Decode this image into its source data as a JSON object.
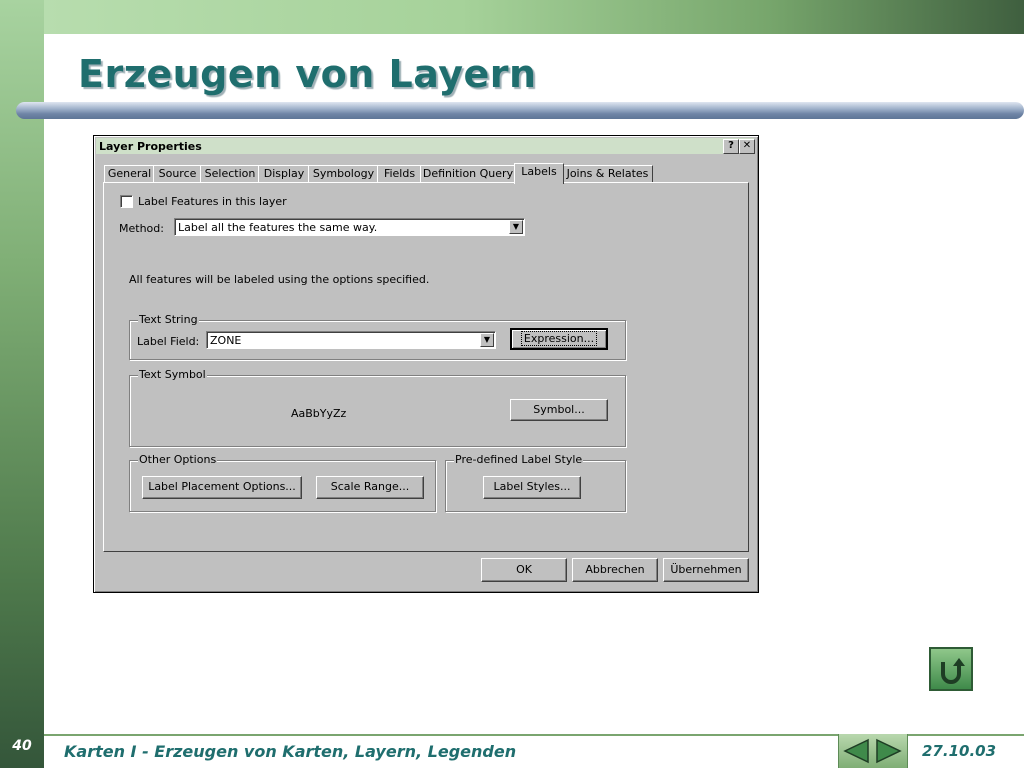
{
  "slide": {
    "title": "Erzeugen von Layern",
    "number": "40",
    "footer_title": "Karten I - Erzeugen von Karten, Layern, Legenden",
    "date": "27.10.03",
    "colors": {
      "title": "#1f6e6e",
      "accent_green": "#7aa56f",
      "rule_blue": "#6f85a6"
    },
    "nav_icons": [
      "prev-arrow-icon",
      "next-arrow-icon",
      "return-icon"
    ]
  },
  "dialog": {
    "title": "Layer Properties",
    "titlebar_buttons": {
      "help": "?",
      "close": "✕"
    },
    "tabs": [
      {
        "label": "General"
      },
      {
        "label": "Source"
      },
      {
        "label": "Selection"
      },
      {
        "label": "Display"
      },
      {
        "label": "Symbology"
      },
      {
        "label": "Fields"
      },
      {
        "label": "Definition Query"
      },
      {
        "label": "Labels",
        "active": true
      },
      {
        "label": "Joins & Relates"
      }
    ],
    "label_features": {
      "label": "Label Features in this layer",
      "checked": false
    },
    "method": {
      "label": "Method:",
      "value": "Label all the features the same way."
    },
    "info_text": "All features will be labeled using the options specified.",
    "text_string": {
      "legend": "Text String",
      "field_label": "Label Field:",
      "field_value": "ZONE",
      "expression_button": "Expression..."
    },
    "text_symbol": {
      "legend": "Text Symbol",
      "sample": "AaBbYyZz",
      "symbol_button": "Symbol..."
    },
    "other_options": {
      "legend": "Other Options",
      "placement_button": "Label Placement Options...",
      "scale_button": "Scale Range..."
    },
    "predefined_style": {
      "legend": "Pre-defined Label Style",
      "styles_button": "Label Styles..."
    },
    "footer_buttons": {
      "ok": "OK",
      "cancel": "Abbrechen",
      "apply": "Übernehmen"
    }
  }
}
